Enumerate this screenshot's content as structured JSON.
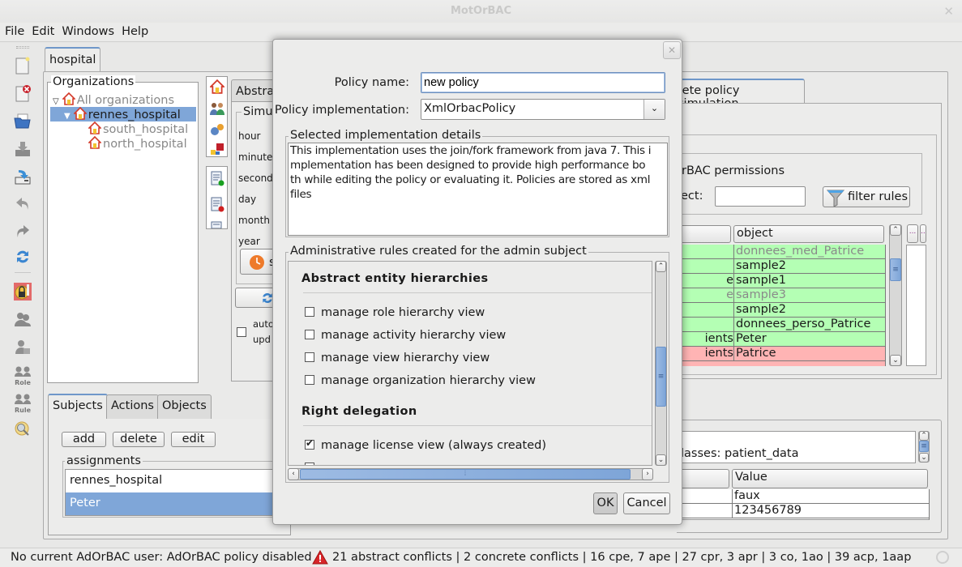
{
  "window": {
    "title": "MotOrBAC",
    "close_label": "✕"
  },
  "menu": [
    "File",
    "Edit",
    "Windows",
    "Help"
  ],
  "toolbar_icons": [
    "new-policy-icon",
    "close-policy-icon",
    "open-folder-icon",
    "save-disabled-icon",
    "save-as-icon",
    "undo-icon",
    "redo-icon",
    "refresh-icon",
    "adorbac-lock-icon",
    "users-icon",
    "user-group-icon",
    "role-icon",
    "rule-icon",
    "search-icon"
  ],
  "policy_tab": "hospital",
  "organizations": {
    "legend": "Organizations",
    "items": [
      {
        "label": "All organizations",
        "level": 0,
        "expanded": true,
        "muted": true
      },
      {
        "label": "rennes_hospital",
        "level": 1,
        "expanded": true,
        "selected": true
      },
      {
        "label": "south_hospital",
        "level": 2,
        "muted": true
      },
      {
        "label": "north_hospital",
        "level": 2,
        "muted": true
      }
    ]
  },
  "entity_tabs": {
    "tabs": [
      "Subjects",
      "Actions",
      "Objects"
    ],
    "active": "Subjects",
    "buttons": {
      "add": "add",
      "delete": "delete",
      "edit": "edit"
    },
    "assignments_legend": "assignments",
    "assignments": [
      {
        "label": "rennes_hospital",
        "selected": false
      },
      {
        "label": "Peter",
        "selected": true
      }
    ]
  },
  "middle_panel": {
    "tab_label": "Abstra",
    "simul_legend": "Simul",
    "fields": [
      "hour",
      "minute",
      "second",
      "day",
      "month",
      "year"
    ],
    "set_time_label": "s",
    "auto_update_label_1": "auto",
    "auto_update_label_2": "upd"
  },
  "right_panel": {
    "tab_label": "rete policy simulation",
    "permissions_label": "rBAC permissions",
    "subject_label": "ect:",
    "subject_value": "",
    "filter_button": "filter rules",
    "table": {
      "headers": [
        "",
        "object"
      ],
      "rows": [
        {
          "c1": "",
          "object": "donnees_med_Patrice",
          "status": "green",
          "muted": true
        },
        {
          "c1": "",
          "object": "sample2",
          "status": "green"
        },
        {
          "c1": "e",
          "object": "sample1",
          "status": "green"
        },
        {
          "c1": "e",
          "object": "sample3",
          "status": "green",
          "muted": true
        },
        {
          "c1": "",
          "object": "sample2",
          "status": "green"
        },
        {
          "c1": "",
          "object": "donnees_perso_Patrice",
          "status": "green"
        },
        {
          "c1": "ients",
          "object": "Peter",
          "status": "green"
        },
        {
          "c1": "ients",
          "object": "Patrice",
          "status": "red"
        }
      ]
    },
    "side_buttons": [
      "...",
      "..."
    ],
    "classes_text": "lasses: patient_data",
    "attr_table": {
      "headers": [
        "",
        "Value"
      ],
      "rows": [
        {
          "c1": "",
          "value": "faux"
        },
        {
          "c1": "",
          "value": "123456789"
        }
      ]
    }
  },
  "dialog": {
    "close_label": "✕",
    "policy_name_label": "Policy name:",
    "policy_name_value": "new policy",
    "policy_impl_label": "Policy implementation:",
    "policy_impl_value": "XmlOrbacPolicy",
    "details_legend": "Selected implementation details",
    "details_text": "This implementation uses the join/fork framework from java 7. This implementation has been designed to provide high performance both while editing the policy or evaluating it. Policies are stored as xml files",
    "details_lines": [
      "This implementation uses the join/fork framework from java 7. This i",
      "mplementation has been designed to provide high performance bo",
      "th while editing the policy or evaluating it. Policies are stored as xml",
      "files"
    ],
    "admin_legend": "Administrative rules created for the admin subject",
    "sections": [
      {
        "title": "Abstract entity hierarchies",
        "items": [
          {
            "label": "manage role hierarchy view",
            "checked": false
          },
          {
            "label": "manage activity hierarchy view",
            "checked": false
          },
          {
            "label": "manage view hierarchy view",
            "checked": false
          },
          {
            "label": "manage organization hierarchy view",
            "checked": false
          }
        ]
      },
      {
        "title": "Right delegation",
        "items": [
          {
            "label": "manage license view (always created)",
            "checked": true
          }
        ]
      }
    ],
    "ok_label": "OK",
    "cancel_label": "Cancel"
  },
  "status": {
    "left": "No current AdOrBAC user: AdOrBAC policy disabled",
    "conflicts": "21 abstract conflicts | 2 concrete conflicts | 16 cpe, 7 ape | 27 cpr, 3 apr | 3 co, 1ao | 39 acp, 1aap",
    "warning_icon": "warning-icon"
  },
  "colors": {
    "selection": "#7fa6d8",
    "accent": "#6f97c9",
    "allowed": "#b4ffb4",
    "denied": "#ffb4b4"
  }
}
